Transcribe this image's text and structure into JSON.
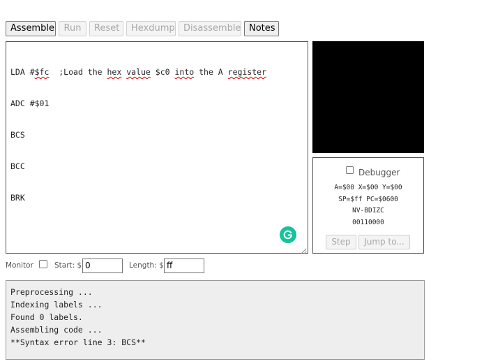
{
  "toolbar": {
    "assemble": "Assemble",
    "run": "Run",
    "reset": "Reset",
    "hexdump": "Hexdump",
    "disassemble": "Disassemble",
    "notes": "Notes"
  },
  "editor": {
    "lines": [
      [
        "LDA #",
        "$fc",
        "  ;Load the ",
        "hex",
        " ",
        "value",
        " $c0 ",
        "into",
        " the A ",
        "register"
      ],
      [
        "ADC #$01"
      ],
      [
        "BCS"
      ],
      [
        "BCC"
      ],
      [
        "BRK"
      ]
    ]
  },
  "debugger": {
    "label": "Debugger",
    "reg_line1": "A=$00 X=$00 Y=$00",
    "reg_line2": "SP=$ff PC=$0600",
    "flags_names": "NV-BDIZC",
    "flags_bits": "00110000",
    "step": "Step",
    "jump": "Jump to..."
  },
  "monitor": {
    "label": "Monitor",
    "start_label": "Start: $",
    "start_value": "0",
    "length_label": "Length: $",
    "length_value": "ff"
  },
  "console": {
    "lines": [
      "Preprocessing ...",
      "Indexing labels ...",
      "Found 0 labels.",
      "Assembling code ...",
      "**Syntax error line 3: BCS**"
    ]
  },
  "colors": {
    "screen": "#000000",
    "grammarly": "#15c39a",
    "spellcheck": "#dd0000"
  }
}
